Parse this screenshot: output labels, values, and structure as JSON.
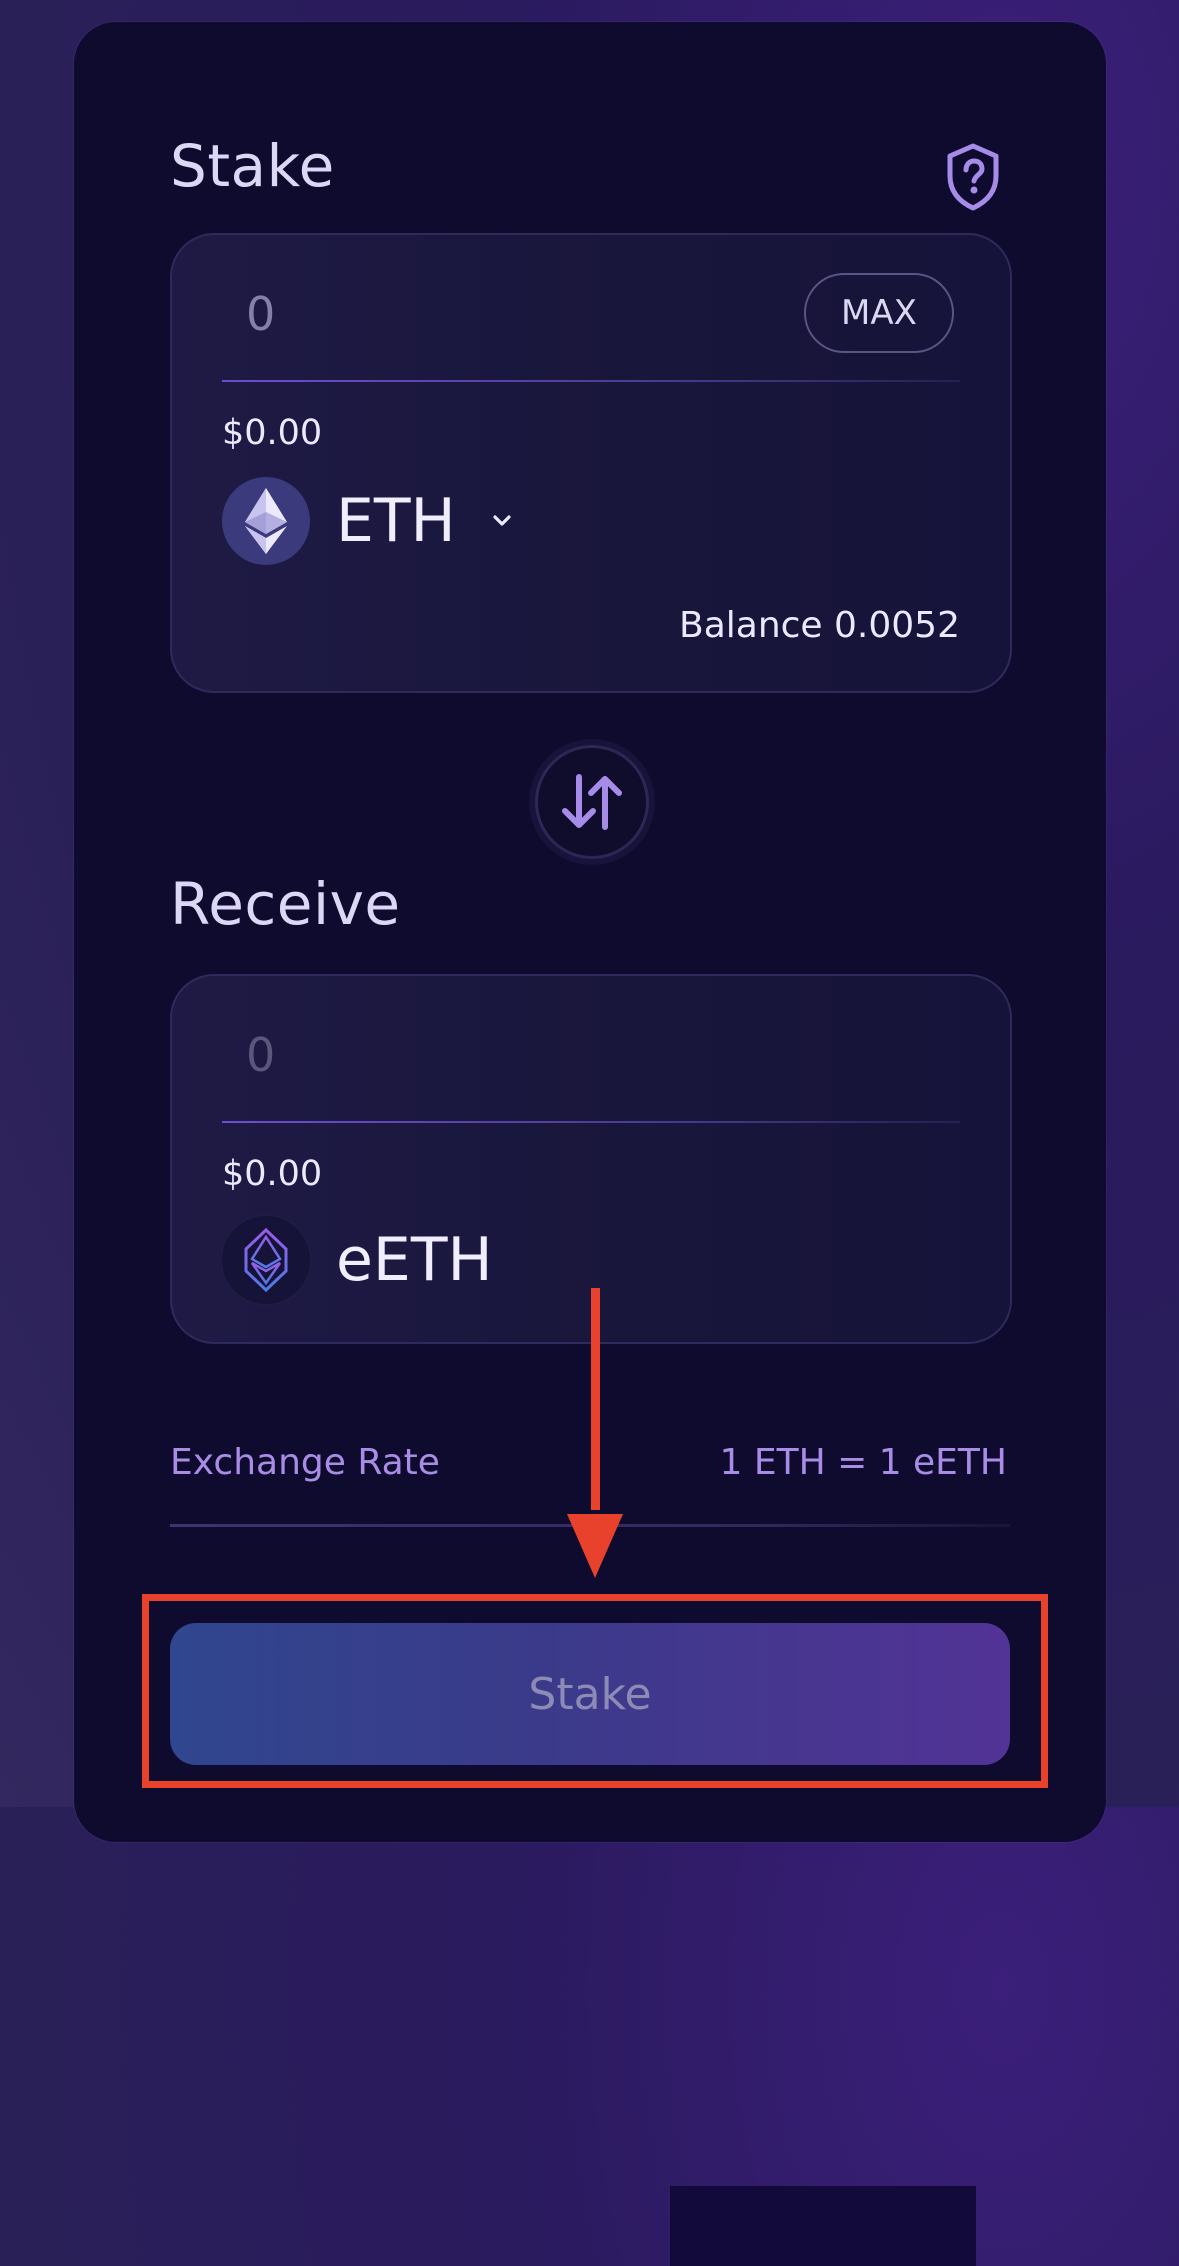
{
  "stake_section": {
    "title": "Stake",
    "amount_value": "0",
    "max_label": "MAX",
    "usd_value": "$0.00",
    "token": "ETH",
    "balance": "Balance 0.0052"
  },
  "receive_section": {
    "title": "Receive",
    "amount_value": "0",
    "usd_value": "$0.00",
    "token": "eETH"
  },
  "exchange_rate": {
    "label": "Exchange Rate",
    "value": "1 ETH = 1 eETH"
  },
  "stake_button": {
    "label": "Stake"
  },
  "icons": {
    "help": "shield-question-icon",
    "swap": "swap-arrows-icon",
    "eth": "eth-logo-icon",
    "eeth": "eeth-logo-icon",
    "chevron": "chevron-down-icon"
  },
  "colors": {
    "background": "#2a1a5e",
    "card": "#0e0b2e",
    "accent": "#a98ce6",
    "highlight": "#e8412c",
    "button_start": "#30468e",
    "button_end": "#523396"
  }
}
